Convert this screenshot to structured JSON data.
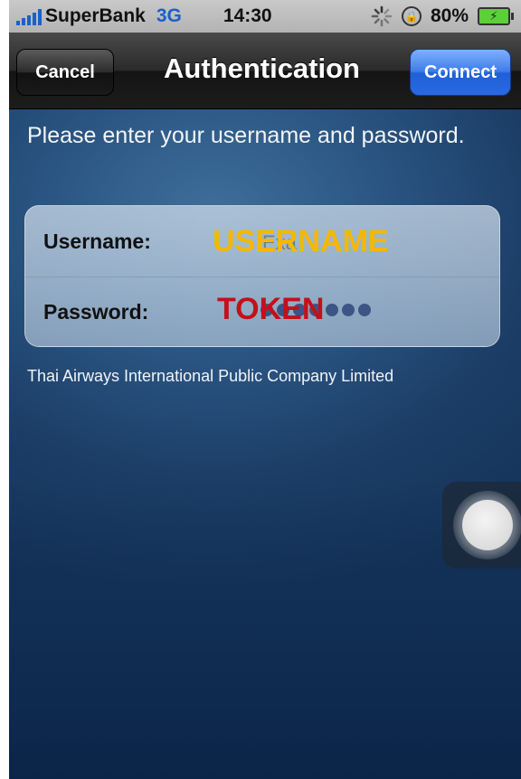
{
  "status_bar": {
    "carrier": "SuperBank",
    "network": "3G",
    "time": "14:30",
    "battery_percent": "80%",
    "icons": [
      "signal-icon",
      "activity-icon",
      "rotation-lock-icon",
      "battery-icon"
    ]
  },
  "nav_bar": {
    "title": "Authentication",
    "cancel_label": "Cancel",
    "connect_label": "Connect"
  },
  "content": {
    "instructions": "Please enter your username and password.",
    "username_label": "Username:",
    "username_placeholder": "Exa",
    "username_overlay": "USERNAME",
    "password_label": "Password:",
    "password_overlay": "TOKEN",
    "company": "Thai Airways International Public Company Limited"
  },
  "colors": {
    "accent_blue": "#2a6ae0",
    "overlay_yellow": "#f5b800",
    "overlay_red": "#c4101a",
    "background": "#1b3d66"
  }
}
